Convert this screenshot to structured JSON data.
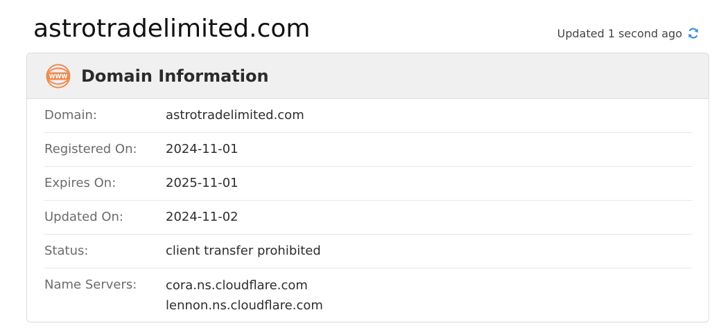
{
  "header": {
    "title": "astrotradelimited.com",
    "updated_text": "Updated 1 second ago",
    "refresh_icon": "refresh-icon",
    "refresh_color": "#3a8ee6"
  },
  "card": {
    "title": "Domain Information",
    "icon": "www-icon",
    "icon_color": "#f08a4b",
    "rows": [
      {
        "label": "Domain:",
        "value": "astrotradelimited.com"
      },
      {
        "label": "Registered On:",
        "value": "2024-11-01"
      },
      {
        "label": "Expires On:",
        "value": "2025-11-01"
      },
      {
        "label": "Updated On:",
        "value": "2024-11-02"
      },
      {
        "label": "Status:",
        "value": "client transfer prohibited"
      },
      {
        "label": "Name Servers:",
        "values": [
          "cora.ns.cloudflare.com",
          "lennon.ns.cloudflare.com"
        ]
      }
    ]
  }
}
